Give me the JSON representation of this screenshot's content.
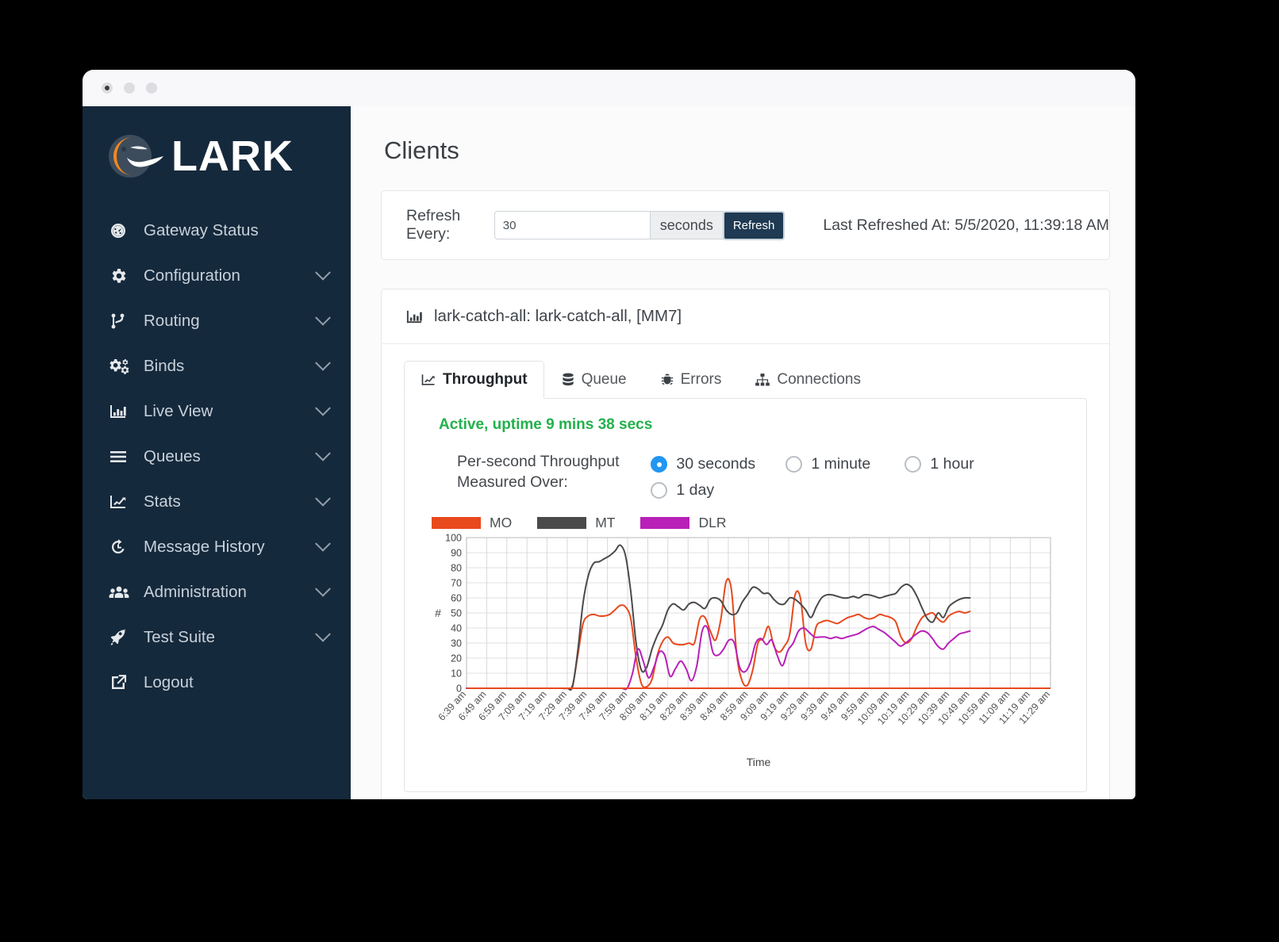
{
  "window": {
    "dots": [
      "close",
      "minimize",
      "maximize"
    ]
  },
  "brand": {
    "name": "LARK"
  },
  "sidebar": {
    "items": [
      {
        "label": "Gateway Status",
        "icon": "gauge-icon",
        "expandable": false
      },
      {
        "label": "Configuration",
        "icon": "gear-icon",
        "expandable": true
      },
      {
        "label": "Routing",
        "icon": "route-icon",
        "expandable": true
      },
      {
        "label": "Binds",
        "icon": "gears-icon",
        "expandable": true
      },
      {
        "label": "Live View",
        "icon": "bar-chart-icon",
        "expandable": true
      },
      {
        "label": "Queues",
        "icon": "list-icon",
        "expandable": true
      },
      {
        "label": "Stats",
        "icon": "line-chart-icon",
        "expandable": true
      },
      {
        "label": "Message History",
        "icon": "history-icon",
        "expandable": true
      },
      {
        "label": "Administration",
        "icon": "users-icon",
        "expandable": true
      },
      {
        "label": "Test Suite",
        "icon": "rocket-icon",
        "expandable": true
      },
      {
        "label": "Logout",
        "icon": "external-link-icon",
        "expandable": false
      }
    ]
  },
  "page": {
    "title": "Clients"
  },
  "refresh_bar": {
    "label": "Refresh Every:",
    "value": "30",
    "placeholder": "30",
    "unit": "seconds",
    "button": "Refresh",
    "last_refreshed": "Last Refreshed At: 5/5/2020, 11:39:18 AM"
  },
  "chart_card": {
    "icon": "bar-chart-icon",
    "title": "lark-catch-all: lark-catch-all, [MM7]",
    "tabs": [
      {
        "label": "Throughput",
        "icon": "chart-line-icon",
        "active": true
      },
      {
        "label": "Queue",
        "icon": "database-icon",
        "active": false
      },
      {
        "label": "Errors",
        "icon": "bug-icon",
        "active": false
      },
      {
        "label": "Connections",
        "icon": "sitemap-icon",
        "active": false
      }
    ],
    "status": "Active, uptime 9 mins 38 secs",
    "status_color": "#22b14c",
    "measure_label": "Per-second Throughput Measured Over:",
    "measure_options": [
      {
        "label": "30 seconds",
        "selected": true
      },
      {
        "label": "1 minute",
        "selected": false
      },
      {
        "label": "1 hour",
        "selected": false
      },
      {
        "label": "1 day",
        "selected": false
      }
    ]
  },
  "chart_data": {
    "type": "line",
    "title": "",
    "xlabel": "Time",
    "ylabel": "#",
    "ylim": [
      0,
      100
    ],
    "yticks": [
      0,
      10,
      20,
      30,
      40,
      50,
      60,
      70,
      80,
      90,
      100
    ],
    "grid": true,
    "legend_position": "top-left",
    "categories": [
      "6:39 am",
      "6:49 am",
      "6:59 am",
      "7:09 am",
      "7:19 am",
      "7:29 am",
      "7:39 am",
      "7:49 am",
      "7:59 am",
      "8:09 am",
      "8:19 am",
      "8:29 am",
      "8:39 am",
      "8:49 am",
      "8:59 am",
      "9:09 am",
      "9:19 am",
      "9:29 am",
      "9:39 am",
      "9:49 am",
      "9:59 am",
      "10:09 am",
      "10:19 am",
      "10:29 am",
      "10:39 am",
      "10:49 am",
      "10:59 am",
      "11:09 am",
      "11:19 am",
      "11:29 am"
    ],
    "x_axis_start": "6:39 am",
    "x_axis_end": "11:29 am",
    "x_tick_interval_minutes": 10,
    "data_ends_at": "10:49 am",
    "series": [
      {
        "name": "MO",
        "color": "#E8491D",
        "values": [
          0,
          0,
          0,
          0,
          0,
          0,
          0,
          0,
          0,
          0,
          0,
          0,
          0,
          0,
          0,
          0,
          0,
          0,
          0,
          0,
          2,
          22,
          43,
          48,
          49,
          48,
          48,
          49,
          52,
          55,
          54,
          46,
          20,
          3,
          1,
          6,
          22,
          31,
          34,
          30,
          29,
          29,
          30,
          30,
          46,
          47,
          38,
          32,
          46,
          71,
          65,
          22,
          5,
          2,
          12,
          30,
          33,
          41,
          28,
          24,
          28,
          36,
          62,
          60,
          30,
          26,
          41,
          44,
          45,
          44,
          43,
          45,
          47,
          48,
          49,
          47,
          46,
          47,
          49,
          48,
          47,
          44,
          34,
          30,
          33,
          41,
          47,
          49,
          50,
          46,
          44,
          48,
          50,
          51,
          50,
          51
        ]
      },
      {
        "name": "MT",
        "color": "#4A4A4A",
        "values": [
          0,
          0,
          0,
          0,
          0,
          0,
          0,
          0,
          0,
          0,
          0,
          0,
          0,
          0,
          0,
          0,
          0,
          0,
          0,
          0,
          1,
          25,
          57,
          75,
          83,
          84,
          86,
          88,
          91,
          95,
          88,
          64,
          30,
          12,
          14,
          26,
          35,
          42,
          52,
          56,
          54,
          52,
          56,
          57,
          55,
          53,
          59,
          60,
          58,
          52,
          49,
          50,
          57,
          62,
          67,
          66,
          63,
          63,
          59,
          56,
          56,
          60,
          59,
          56,
          52,
          47,
          54,
          60,
          62,
          62,
          61,
          60,
          60,
          61,
          60,
          62,
          62,
          61,
          60,
          61,
          62,
          63,
          67,
          69,
          67,
          61,
          53,
          46,
          44,
          50,
          47,
          54,
          57,
          59,
          60,
          60
        ]
      },
      {
        "name": "DLR",
        "color": "#B820B8",
        "values": [
          0,
          0,
          0,
          0,
          0,
          0,
          0,
          0,
          0,
          0,
          0,
          0,
          0,
          0,
          0,
          0,
          0,
          0,
          0,
          0,
          0,
          0,
          0,
          0,
          0,
          0,
          0,
          0,
          0,
          0,
          0,
          10,
          26,
          18,
          7,
          14,
          24,
          22,
          8,
          13,
          18,
          13,
          5,
          15,
          38,
          40,
          24,
          22,
          26,
          32,
          30,
          14,
          11,
          17,
          30,
          33,
          29,
          32,
          22,
          15,
          25,
          30,
          38,
          40,
          37,
          34,
          34,
          34,
          33,
          34,
          33,
          34,
          35,
          36,
          38,
          40,
          41,
          39,
          37,
          34,
          31,
          28,
          30,
          33,
          36,
          38,
          37,
          33,
          28,
          26,
          30,
          33,
          36,
          37,
          38
        ]
      }
    ]
  }
}
